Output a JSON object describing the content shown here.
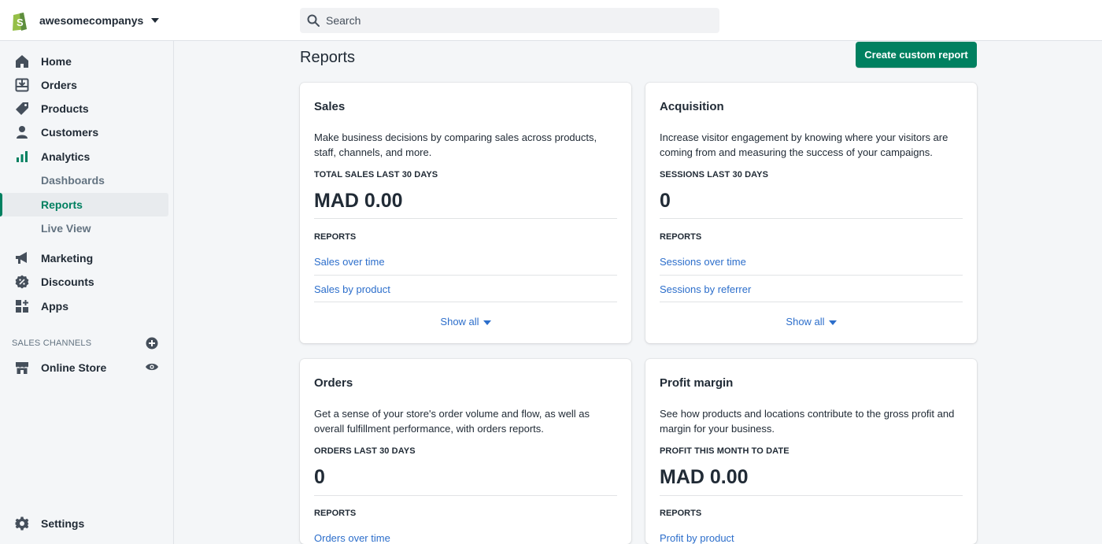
{
  "topbar": {
    "store_name": "awesomecompanyst...",
    "search_placeholder": "Search"
  },
  "sidebar": {
    "items": [
      {
        "label": "Home",
        "icon": "home-icon"
      },
      {
        "label": "Orders",
        "icon": "orders-icon"
      },
      {
        "label": "Products",
        "icon": "tag-icon"
      },
      {
        "label": "Customers",
        "icon": "person-icon"
      },
      {
        "label": "Analytics",
        "icon": "bar-chart-icon"
      },
      {
        "label": "Dashboards"
      },
      {
        "label": "Reports"
      },
      {
        "label": "Live View"
      },
      {
        "label": "Marketing",
        "icon": "megaphone-icon"
      },
      {
        "label": "Discounts",
        "icon": "discount-icon"
      },
      {
        "label": "Apps",
        "icon": "apps-icon"
      }
    ],
    "active_item": "Reports",
    "sales_channels_label": "SALES CHANNELS",
    "online_store": "Online Store",
    "settings": "Settings"
  },
  "main": {
    "title": "Reports",
    "create_button": "Create custom report",
    "cards": [
      {
        "title": "Sales",
        "description": "Make business decisions by comparing sales across products, staff, channels, and more.",
        "metric_label": "TOTAL SALES LAST 30 DAYS",
        "metric_value": "MAD 0.00",
        "reports_label": "REPORTS",
        "links": [
          "Sales over time",
          "Sales by product"
        ],
        "show_all": "Show all"
      },
      {
        "title": "Acquisition",
        "description": "Increase visitor engagement by knowing where your visitors are coming from and measuring the success of your campaigns.",
        "metric_label": "SESSIONS LAST 30 DAYS",
        "metric_value": "0",
        "reports_label": "REPORTS",
        "links": [
          "Sessions over time",
          "Sessions by referrer"
        ],
        "show_all": "Show all"
      },
      {
        "title": "Orders",
        "description": "Get a sense of your store's order volume and flow, as well as overall fulfillment performance, with orders reports.",
        "metric_label": "ORDERS LAST 30 DAYS",
        "metric_value": "0",
        "reports_label": "REPORTS",
        "links": [
          "Orders over time"
        ]
      },
      {
        "title": "Profit margin",
        "description": "See how products and locations contribute to the gross profit and margin for your business.",
        "metric_label": "PROFIT THIS MONTH TO DATE",
        "metric_value": "MAD 0.00",
        "reports_label": "REPORTS",
        "links": [
          "Profit by product"
        ]
      }
    ]
  },
  "colors": {
    "brand_green": "#008060",
    "link_blue": "#2c6ecb",
    "text": "#212b36",
    "subdued": "#637381"
  }
}
